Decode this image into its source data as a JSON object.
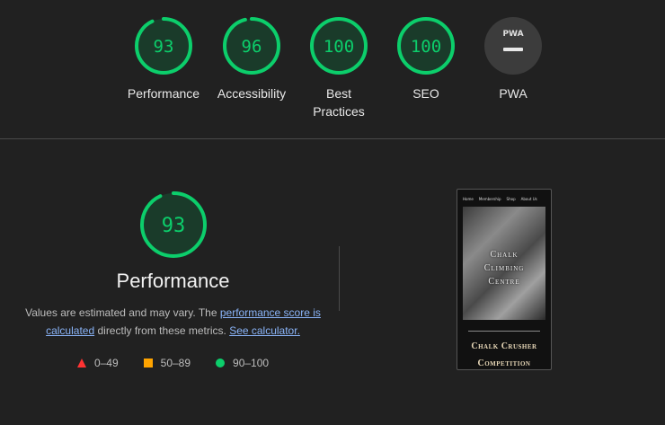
{
  "scores": [
    {
      "id": "performance",
      "value": "93",
      "label": "Performance",
      "fraction": 0.93
    },
    {
      "id": "accessibility",
      "value": "96",
      "label": "Accessibility",
      "fraction": 0.96
    },
    {
      "id": "best-practices",
      "value": "100",
      "label": "Best Practices",
      "fraction": 1.0
    },
    {
      "id": "seo",
      "value": "100",
      "label": "SEO",
      "fraction": 1.0
    },
    {
      "id": "pwa",
      "value": "",
      "label": "PWA",
      "badge": "PWA"
    }
  ],
  "colors": {
    "pass": "#0cce6b",
    "average": "#ffa400",
    "fail": "#ff3333",
    "track_pass": "#1a3b2a"
  },
  "performance": {
    "score": "93",
    "title": "Performance",
    "desc_prefix": "Values are estimated and may vary. The ",
    "link_score": "performance score is calculated",
    "desc_middle": " directly from these metrics. ",
    "link_calc": "See calculator.",
    "legend": [
      {
        "shape": "triangle",
        "range": "0–49"
      },
      {
        "shape": "square",
        "range": "50–89"
      },
      {
        "shape": "circle",
        "range": "90–100"
      }
    ]
  },
  "screenshot": {
    "nav": [
      "Home",
      "Membership",
      "Shop",
      "About Us"
    ],
    "hero_lines": [
      "Chalk",
      "Climbing",
      "Centre"
    ],
    "competition_lines": [
      "Chalk Crusher",
      "Competition"
    ]
  }
}
